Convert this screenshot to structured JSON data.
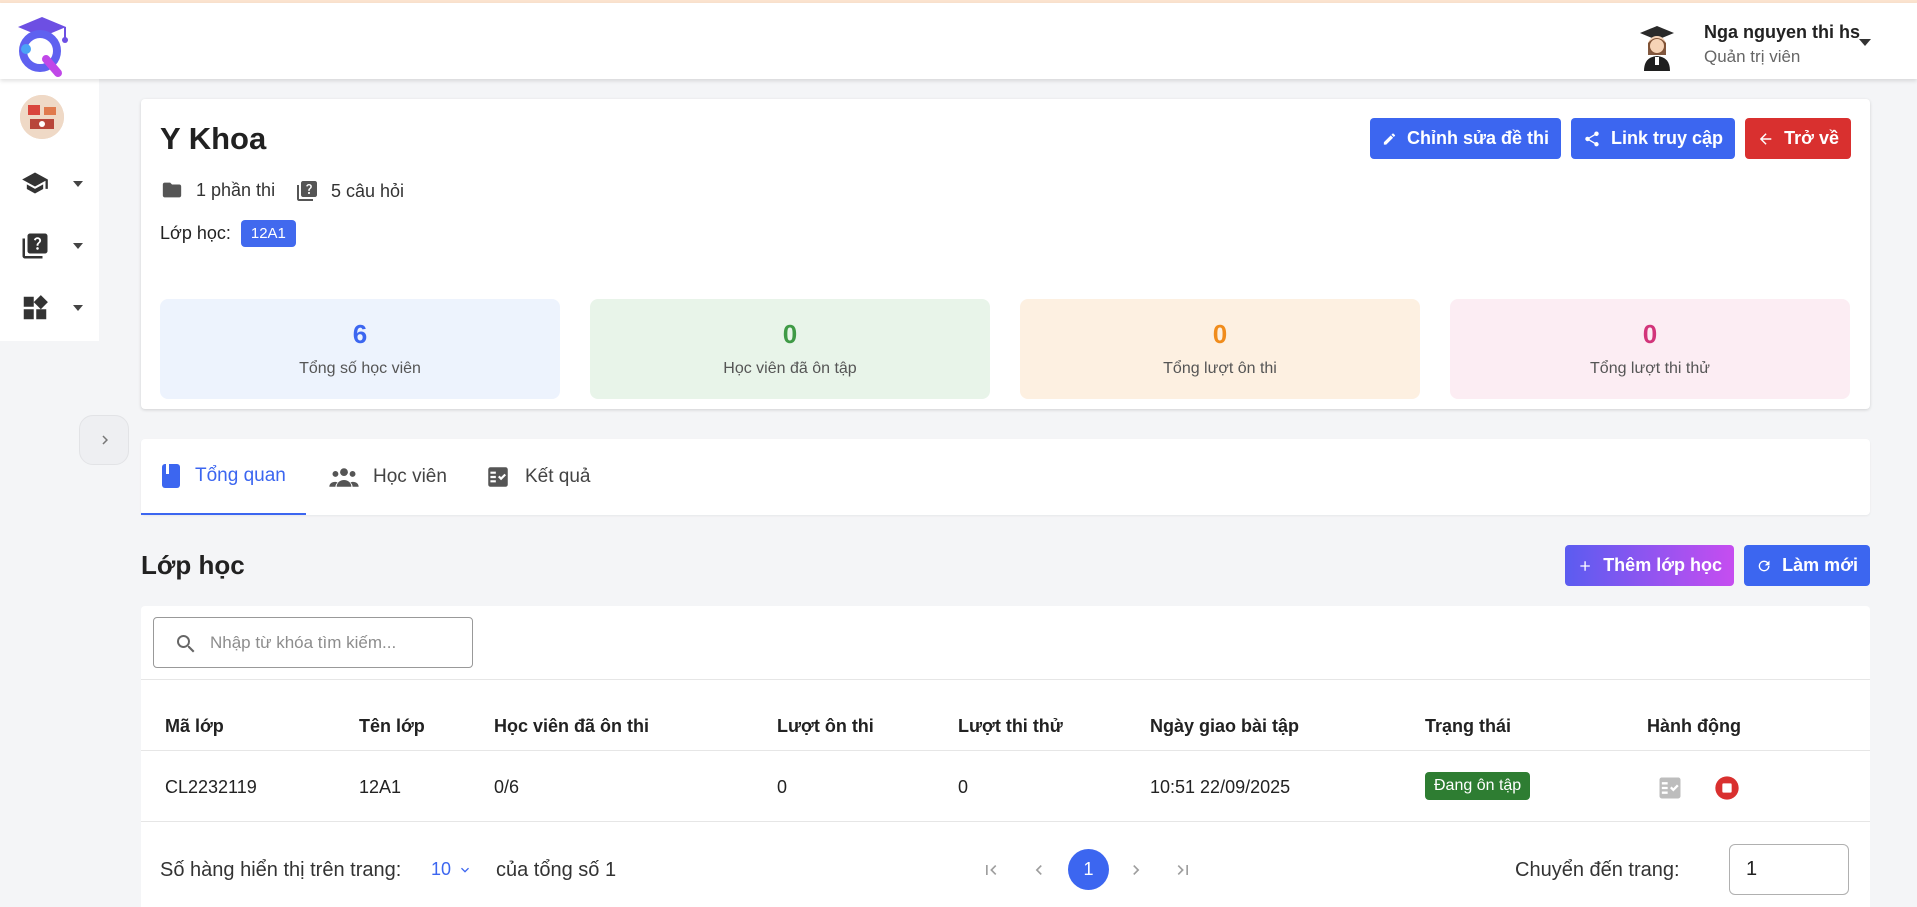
{
  "header": {
    "user_name": "Nga nguyen thi hs",
    "user_role": "Quản trị viên"
  },
  "sidebar": {
    "items": [
      {
        "icon": "graduation-cap-icon"
      },
      {
        "icon": "question-library-icon"
      },
      {
        "icon": "dashboard-icon"
      }
    ]
  },
  "exam": {
    "title": "Y Khoa",
    "sections": "1 phần thi",
    "questions": "5 câu hỏi",
    "class_label": "Lớp học:",
    "class_chip": "12A1",
    "buttons": {
      "edit": "Chỉnh sửa đề thi",
      "access_link": "Link truy cập",
      "back": "Trở về"
    }
  },
  "stats": [
    {
      "value": "6",
      "label": "Tổng số học viên",
      "color": "#3c66f0",
      "bg": "#edf3fd"
    },
    {
      "value": "0",
      "label": "Học viên đã ôn tập",
      "color": "#3f9a46",
      "bg": "#e8f4e9"
    },
    {
      "value": "0",
      "label": "Tổng lượt ôn thi",
      "color": "#f08c1c",
      "bg": "#fdf0e1"
    },
    {
      "value": "0",
      "label": "Tổng lượt thi thử",
      "color": "#d2357a",
      "bg": "#fcedf3"
    }
  ],
  "tabs": [
    {
      "label": "Tổng quan",
      "active": true
    },
    {
      "label": "Học viên",
      "active": false
    },
    {
      "label": "Kết quả",
      "active": false
    }
  ],
  "section": {
    "title": "Lớp học",
    "add_button": "Thêm lớp học",
    "refresh_button": "Làm mới"
  },
  "table": {
    "search_placeholder": "Nhập từ khóa tìm kiếm...",
    "columns": [
      "Mã lớp",
      "Tên lớp",
      "Học viên đã ôn thi",
      "Lượt ôn thi",
      "Lượt thi thử",
      "Ngày giao bài tập",
      "Trạng thái",
      "Hành động"
    ],
    "rows": [
      {
        "code": "CL2232119",
        "name": "12A1",
        "reviewed": "0/6",
        "review_count": "0",
        "mock_count": "0",
        "assigned_date": "10:51 22/09/2025",
        "status": "Đang ôn tập"
      }
    ]
  },
  "pagination": {
    "rows_label": "Số hàng hiển thị trên trang:",
    "rows_value": "10",
    "total_label": "của tổng số 1",
    "current_page": "1",
    "goto_label": "Chuyển đến trang:",
    "goto_value": "1"
  }
}
